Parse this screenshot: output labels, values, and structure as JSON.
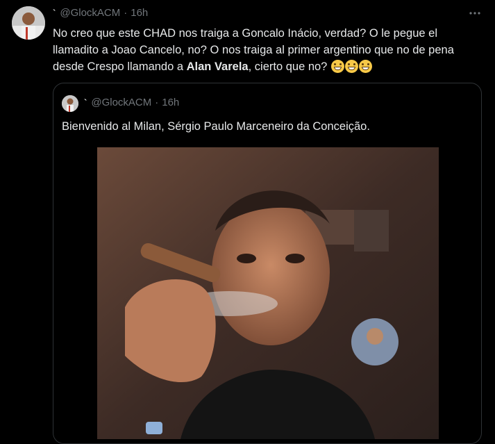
{
  "tweet": {
    "tick": "`",
    "handle": "@GlockACM",
    "separator": "·",
    "time": "16h",
    "text_before_bold": "No creo que este CHAD nos traiga a Goncalo Inácio, verdad? O le pegue el llamadito a Joao Cancelo, no? O nos traiga al primer argentino que no de pena desde Crespo llamando a ",
    "text_bold": "Alan Varela",
    "text_after_bold": ", cierto que no?",
    "emojis": [
      "grinning-face-icon",
      "grinning-face-icon",
      "grinning-face-icon"
    ]
  },
  "quote": {
    "tick": "`",
    "handle": "@GlockACM",
    "separator": "·",
    "time": "16h",
    "text": "Bienvenido al Milan, Sérgio Paulo Marceneiro da Conceição."
  },
  "colors": {
    "background": "#000000",
    "text": "#e7e9ea",
    "secondary_text": "#71767b",
    "border": "#2f3336"
  }
}
